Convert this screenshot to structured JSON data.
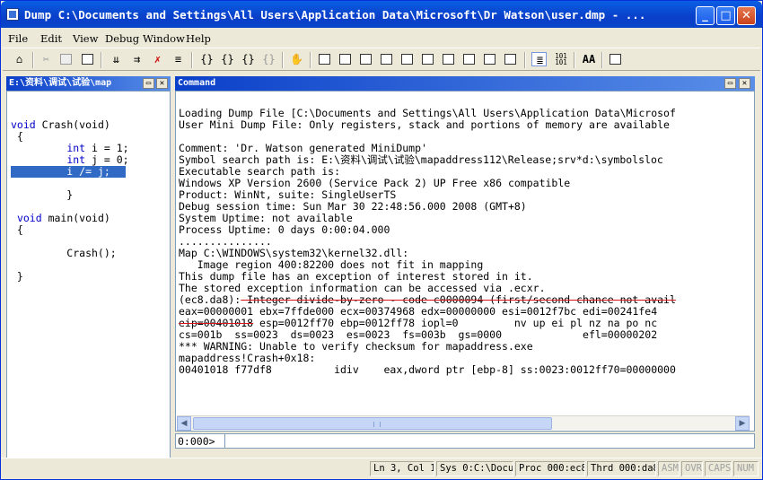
{
  "window": {
    "title": "Dump C:\\Documents and Settings\\All Users\\Application Data\\Microsoft\\Dr Watson\\user.dmp - ...",
    "min_label": "_",
    "max_label": "□",
    "close_label": "✕"
  },
  "menu": [
    "File",
    "Edit",
    "View",
    "Debug",
    "Window",
    "Help"
  ],
  "toolbar": {
    "icons": [
      "open-icon",
      "cut-icon",
      "copy-icon",
      "paste-icon",
      "go-icon",
      "restart-icon",
      "stop-debugging-icon",
      "break-icon",
      "step-into-icon",
      "step-over-icon",
      "step-out-icon",
      "run-to-cursor-icon",
      "hand-icon",
      "command-window-icon",
      "watch-icon",
      "locals-icon",
      "registers-icon",
      "memory-icon",
      "call-stack-icon",
      "disassembly-icon",
      "scratch-pad-icon",
      "source-mode-icon",
      "hex-mode-icon",
      "font-icon",
      "options-icon"
    ],
    "hex_label": "101\n101",
    "font_label": "AA"
  },
  "source": {
    "title": "E:\\资料\\调试\\试验\\map",
    "lines": [
      "",
      "void Crash(void)",
      " {",
      "         int i = 1;",
      "         int j = 0;",
      "         i /= j;",
      "",
      "         }",
      " void main(void)",
      " {",
      "",
      "         Crash();",
      "",
      " }"
    ]
  },
  "command": {
    "title": "Command",
    "lines": [
      "",
      "Loading Dump File [C:\\Documents and Settings\\All Users\\Application Data\\Microsof",
      "User Mini Dump File: Only registers, stack and portions of memory are available",
      "",
      "Comment: 'Dr. Watson generated MiniDump'",
      "Symbol search path is: E:\\资料\\调试\\试验\\mapaddress112\\Release;srv*d:\\symbolsloc",
      "Executable search path is:",
      "Windows XP Version 2600 (Service Pack 2) UP Free x86 compatible",
      "Product: WinNt, suite: SingleUserTS",
      "Debug session time: Sun Mar 30 22:48:56.000 2008 (GMT+8)",
      "System Uptime: not available",
      "Process Uptime: 0 days 0:00:04.000",
      "...............",
      "Map C:\\WINDOWS\\system32\\kernel32.dll:",
      "   Image region 400:82200 does not fit in mapping",
      "This dump file has an exception of interest stored in it.",
      "The stored exception information can be accessed via .ecxr.",
      "(ec8.da8): Integer divide-by-zero - code c0000094 (first/second chance not avail",
      "eax=00000001 ebx=7ffde000 ecx=00374968 edx=00000000 esi=0012f7bc edi=00241fe4",
      "eip=00401018 esp=0012ff70 ebp=0012ff78 iopl=0         nv up ei pl nz na po nc",
      "cs=001b  ss=0023  ds=0023  es=0023  fs=003b  gs=0000             efl=00000202",
      "*** WARNING: Unable to verify checksum for mapaddress.exe",
      "mapaddress!Crash+0x18:",
      "00401018 f77df8          idiv    eax,dword ptr [ebp-8] ss:0023:0012ff70=00000000"
    ],
    "prompt": "0:000>",
    "input_value": ""
  },
  "status": {
    "position": "Ln 3, Col 1",
    "sys": "Sys 0:C:\\Docu",
    "proc": "Proc 000:ec8",
    "thrd": "Thrd 000:da8",
    "asm": "ASM",
    "ovr": "OVR",
    "caps": "CAPS",
    "num": "NUM"
  }
}
